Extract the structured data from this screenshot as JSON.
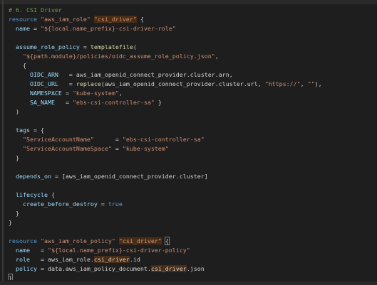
{
  "editor": {
    "lines": [
      [
        {
          "t": "# 6. CSI Driver",
          "c": "tok-comment"
        }
      ],
      [
        {
          "t": "resource ",
          "c": "tok-keyword"
        },
        {
          "t": "\"aws_iam_role\"",
          "c": "tok-string"
        },
        {
          "t": " ",
          "c": "tok-plain"
        },
        {
          "t": "\"csi_driver\"",
          "c": "tok-hl"
        },
        {
          "t": " {",
          "c": "tok-punct"
        }
      ],
      [
        {
          "t": "  name ",
          "c": "tok-ident"
        },
        {
          "t": "= ",
          "c": "tok-punct"
        },
        {
          "t": "\"${local.name_prefix}-csi-driver-role\"",
          "c": "tok-string"
        }
      ],
      [],
      [
        {
          "t": "  assume_role_policy ",
          "c": "tok-ident"
        },
        {
          "t": "= ",
          "c": "tok-punct"
        },
        {
          "t": "templatefile",
          "c": "tok-func"
        },
        {
          "t": "(",
          "c": "tok-punct"
        }
      ],
      [
        {
          "t": "    \"${path.module}/policies/oidc_assume_role_policy.json\"",
          "c": "tok-string"
        },
        {
          "t": ",",
          "c": "tok-punct"
        }
      ],
      [
        {
          "t": "    {",
          "c": "tok-punct"
        }
      ],
      [
        {
          "t": "      OIDC_ARN   ",
          "c": "tok-ident"
        },
        {
          "t": "= aws_iam_openid_connect_provider.cluster.arn,",
          "c": "tok-plain"
        }
      ],
      [
        {
          "t": "      OIDC_URL   ",
          "c": "tok-ident"
        },
        {
          "t": "= ",
          "c": "tok-plain"
        },
        {
          "t": "replace",
          "c": "tok-func"
        },
        {
          "t": "(aws_iam_openid_connect_provider.cluster.url, ",
          "c": "tok-plain"
        },
        {
          "t": "\"https://\"",
          "c": "tok-string"
        },
        {
          "t": ", ",
          "c": "tok-plain"
        },
        {
          "t": "\"\"",
          "c": "tok-string"
        },
        {
          "t": "),",
          "c": "tok-plain"
        }
      ],
      [
        {
          "t": "      NAMESPACE ",
          "c": "tok-ident"
        },
        {
          "t": "= ",
          "c": "tok-plain"
        },
        {
          "t": "\"kube-system\"",
          "c": "tok-string"
        },
        {
          "t": ",",
          "c": "tok-plain"
        }
      ],
      [
        {
          "t": "      SA_NAME   ",
          "c": "tok-ident"
        },
        {
          "t": "= ",
          "c": "tok-plain"
        },
        {
          "t": "\"ebs-csi-controller-sa\"",
          "c": "tok-string"
        },
        {
          "t": " }",
          "c": "tok-plain"
        }
      ],
      [
        {
          "t": "  )",
          "c": "tok-punct"
        }
      ],
      [],
      [
        {
          "t": "  tags ",
          "c": "tok-ident"
        },
        {
          "t": "= {",
          "c": "tok-punct"
        }
      ],
      [
        {
          "t": "    \"ServiceAccountName\"",
          "c": "tok-string"
        },
        {
          "t": "      = ",
          "c": "tok-plain"
        },
        {
          "t": "\"ebs-csi-controller-sa\"",
          "c": "tok-string"
        }
      ],
      [
        {
          "t": "    \"ServiceAccountNameSpace\"",
          "c": "tok-string"
        },
        {
          "t": " = ",
          "c": "tok-plain"
        },
        {
          "t": "\"kube-system\"",
          "c": "tok-string"
        }
      ],
      [
        {
          "t": "  }",
          "c": "tok-punct"
        }
      ],
      [],
      [
        {
          "t": "  depends_on ",
          "c": "tok-ident"
        },
        {
          "t": "= [aws_iam_openid_connect_provider.cluster]",
          "c": "tok-plain"
        }
      ],
      [],
      [
        {
          "t": "  lifecycle ",
          "c": "tok-ident"
        },
        {
          "t": "{",
          "c": "tok-punct"
        }
      ],
      [
        {
          "t": "    create_before_destroy ",
          "c": "tok-ident"
        },
        {
          "t": "= ",
          "c": "tok-plain"
        },
        {
          "t": "true",
          "c": "tok-keyword"
        }
      ],
      [
        {
          "t": "  }",
          "c": "tok-punct"
        }
      ],
      [
        {
          "t": "}",
          "c": "tok-punct"
        }
      ],
      [],
      [
        {
          "t": "resource ",
          "c": "tok-keyword"
        },
        {
          "t": "\"aws_iam_role_policy\"",
          "c": "tok-string"
        },
        {
          "t": " ",
          "c": "tok-plain"
        },
        {
          "t": "\"csi_driver\"",
          "c": "tok-hl"
        },
        {
          "t": " ",
          "c": "tok-plain"
        },
        {
          "t": "{",
          "c": "tok-bracket-match"
        }
      ],
      [
        {
          "t": "  name   ",
          "c": "tok-ident"
        },
        {
          "t": "= ",
          "c": "tok-plain"
        },
        {
          "t": "\"${local.name_prefix}-csi-driver-policy\"",
          "c": "tok-string"
        }
      ],
      [
        {
          "t": "  role   ",
          "c": "tok-ident"
        },
        {
          "t": "= aws_iam_role.",
          "c": "tok-plain"
        },
        {
          "t": "csi_driver",
          "c": "tok-hl-ident"
        },
        {
          "t": ".id",
          "c": "tok-plain"
        }
      ],
      [
        {
          "t": "  policy ",
          "c": "tok-ident"
        },
        {
          "t": "= data.aws_iam_policy_document.",
          "c": "tok-plain"
        },
        {
          "t": "csi_driver",
          "c": "tok-hl-ident"
        },
        {
          "t": ".json",
          "c": "tok-plain"
        }
      ],
      [
        {
          "t": "}",
          "c": "tok-bracket-match"
        }
      ]
    ]
  }
}
